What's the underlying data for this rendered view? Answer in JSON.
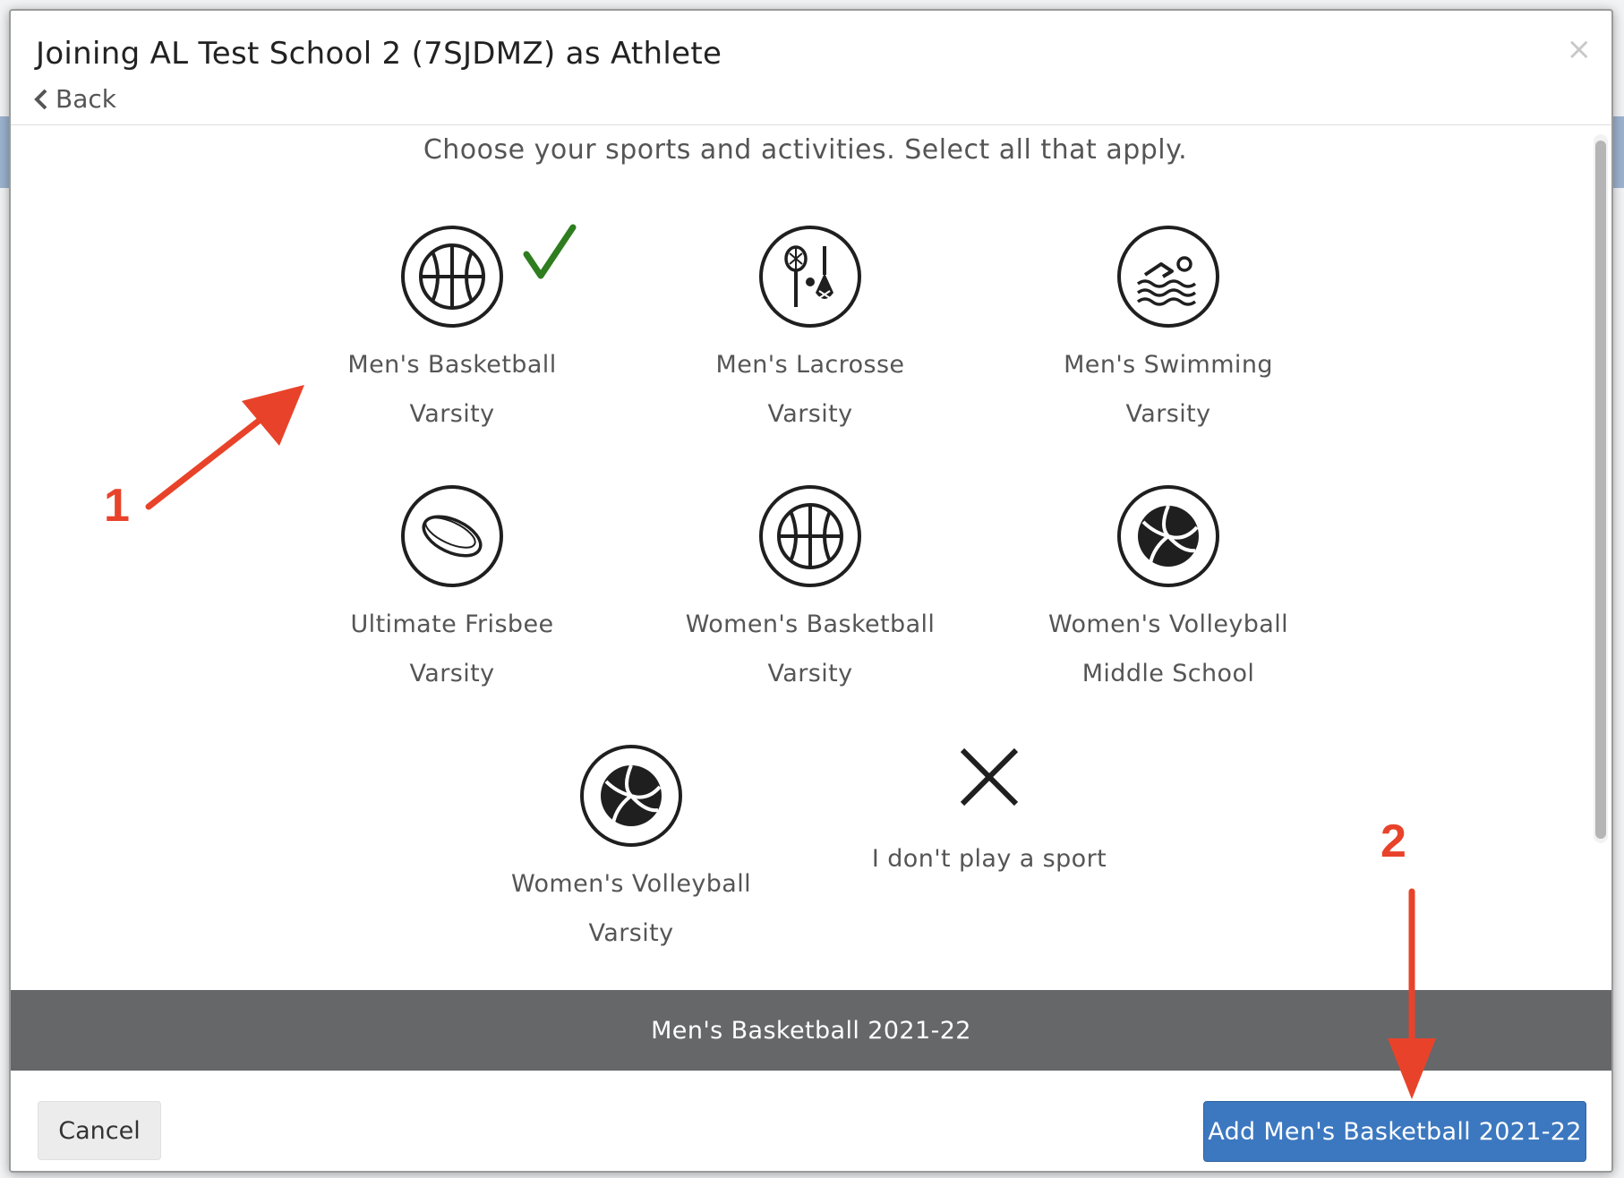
{
  "modal": {
    "title": "Joining AL Test School 2 (7SJDMZ) as Athlete",
    "back_label": "Back",
    "close_label": "×",
    "instructions": "Choose your sports and activities. Select all that apply."
  },
  "sports": [
    {
      "name": "Men's Basketball",
      "level": "Varsity",
      "icon": "basketball-icon",
      "selected": true
    },
    {
      "name": "Men's Lacrosse",
      "level": "Varsity",
      "icon": "lacrosse-icon",
      "selected": false
    },
    {
      "name": "Men's Swimming",
      "level": "Varsity",
      "icon": "swimming-icon",
      "selected": false
    },
    {
      "name": "Ultimate Frisbee",
      "level": "Varsity",
      "icon": "frisbee-icon",
      "selected": false
    },
    {
      "name": "Women's Basketball",
      "level": "Varsity",
      "icon": "basketball-icon",
      "selected": false
    },
    {
      "name": "Women's Volleyball",
      "level": "Middle School",
      "icon": "volleyball-icon",
      "selected": false
    },
    {
      "name": "Women's Volleyball",
      "level": "Varsity",
      "icon": "volleyball-icon",
      "selected": false
    }
  ],
  "none_option": {
    "label": "I don't play a sport",
    "icon": "x-icon"
  },
  "selection_bar": {
    "text": "Men's Basketball 2021-22"
  },
  "footer": {
    "cancel_label": "Cancel",
    "add_label": "Add Men's Basketball 2021-22"
  },
  "annotations": {
    "step1": "1",
    "step2": "2"
  },
  "colors": {
    "accent_blue": "#3c78c0",
    "check_green": "#2e7d1e",
    "annotation_red": "#e8432a",
    "selection_bar_gray": "#666769"
  }
}
